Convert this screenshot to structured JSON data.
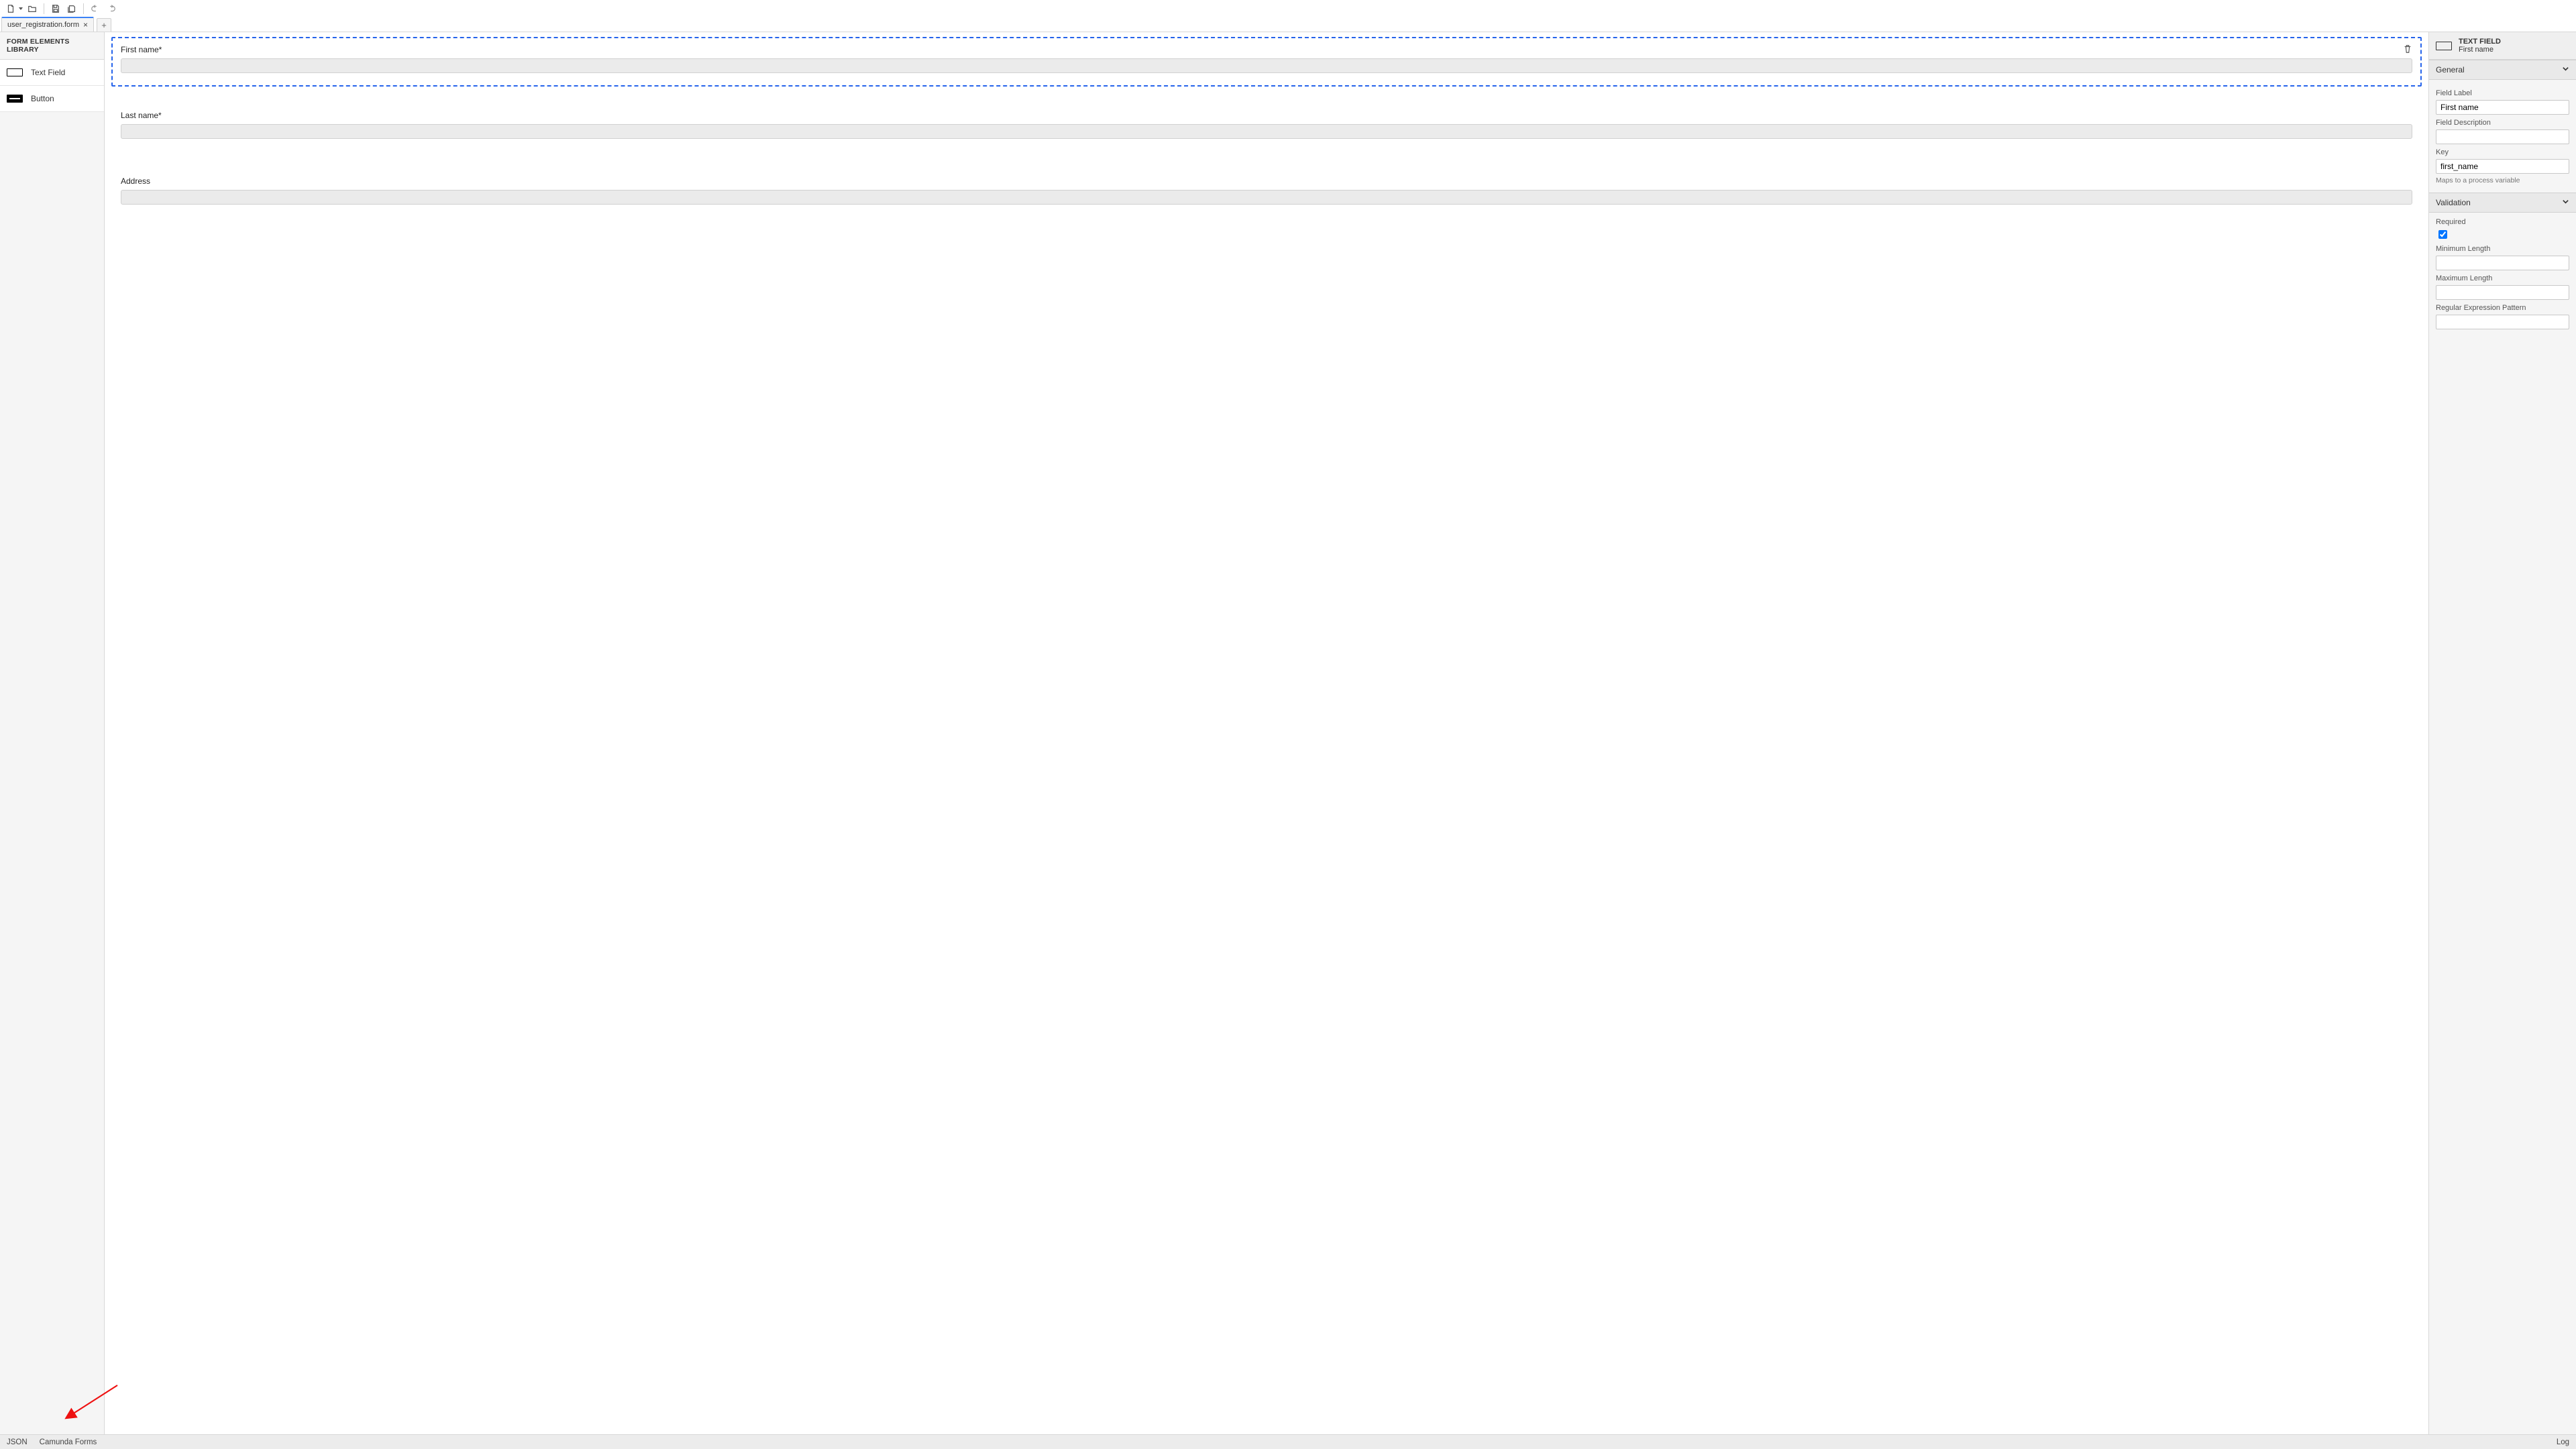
{
  "toolbar": {
    "icons": [
      "new",
      "open",
      "save",
      "save-all",
      "undo",
      "redo"
    ]
  },
  "tab": {
    "title": "user_registration.form",
    "plus": "+"
  },
  "palette": {
    "header": "FORM ELEMENTS LIBRARY",
    "items": [
      {
        "label": "Text Field",
        "kind": "textfield"
      },
      {
        "label": "Button",
        "kind": "button"
      }
    ]
  },
  "canvas": {
    "fields": [
      {
        "label": "First name*",
        "selected": true
      },
      {
        "label": "Last name*",
        "selected": false
      },
      {
        "label": "Address",
        "selected": false
      }
    ]
  },
  "props": {
    "type_label": "TEXT FIELD",
    "name": "First name",
    "sections": {
      "general": {
        "title": "General",
        "field_label_lbl": "Field Label",
        "field_label": "First name",
        "field_desc_lbl": "Field Description",
        "field_desc": "",
        "key_lbl": "Key",
        "key": "first_name",
        "key_hint": "Maps to a process variable"
      },
      "validation": {
        "title": "Validation",
        "required_lbl": "Required",
        "required": true,
        "minlen_lbl": "Minimum Length",
        "minlen": "",
        "maxlen_lbl": "Maximum Length",
        "maxlen": "",
        "regex_lbl": "Regular Expression Pattern",
        "regex": ""
      }
    }
  },
  "footer": {
    "json": "JSON",
    "camunda": "Camunda Forms",
    "log": "Log"
  }
}
